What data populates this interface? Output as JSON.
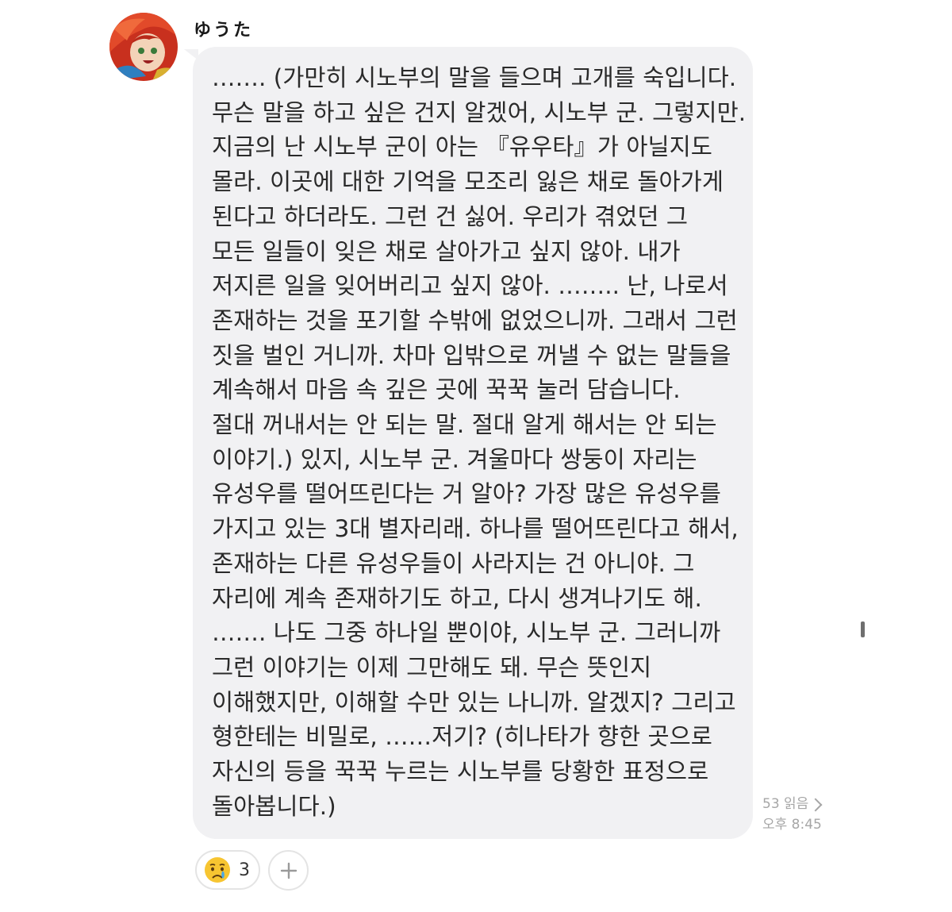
{
  "message": {
    "sender": "ゆうた",
    "lines": [
      "……. (가만히 시노부의 말을 들으며 고개를 숙입니다.",
      "무슨 말을 하고 싶은 건지 알겠어, 시노부 군. 그렇지만.",
      "지금의 난 시노부 군이 아는 『유우타』가 아닐지도",
      "몰라. 이곳에 대한 기억을 모조리 잃은 채로 돌아가게",
      "된다고 하더라도. 그런 건 싫어. 우리가 겪었던 그",
      "모든 일들이 잊은 채로 살아가고 싶지 않아. 내가",
      "저지른 일을 잊어버리고 싶지 않아. …….. 난, 나로서",
      "존재하는 것을 포기할 수밖에 없었으니까. 그래서 그런",
      "짓을 벌인 거니까. 차마 입밖으로 꺼낼 수 없는 말들을",
      "계속해서 마음 속 깊은 곳에 꾹꾹 눌러 담습니다.",
      "절대 꺼내서는 안 되는 말. 절대 알게 해서는 안 되는",
      "이야기.) 있지, 시노부 군. 겨울마다 쌍둥이 자리는",
      "유성우를 떨어뜨린다는 거 알아? 가장 많은 유성우를",
      "가지고 있는 3대 별자리래. 하나를 떨어뜨린다고 해서,",
      "존재하는 다른 유성우들이 사라지는 건 아니야. 그",
      "자리에 계속 존재하기도 하고, 다시 생겨나기도 해.",
      "……. 나도 그중 하나일 뿐이야, 시노부 군. 그러니까",
      "그런 이야기는 이제 그만해도 돼. 무슨 뜻인지",
      "이해했지만, 이해할 수만 있는 나니까. 알겠지? 그리고",
      "형한테는 비밀로, ……저기? (히나타가 향한 곳으로",
      "자신의 등을 꾹꾹 누르는 시노부를 당황한 표정으로",
      "돌아봅니다.)"
    ],
    "read_count": "53 읽음",
    "time": "오후 8:45"
  },
  "reactions": {
    "emoji_icon": "crying-face-icon",
    "count": "3",
    "add_icon": "plus-icon"
  },
  "colors": {
    "bubble": "#f1f1f3",
    "text": "#2a2a2a",
    "meta": "#a6a6a6"
  }
}
